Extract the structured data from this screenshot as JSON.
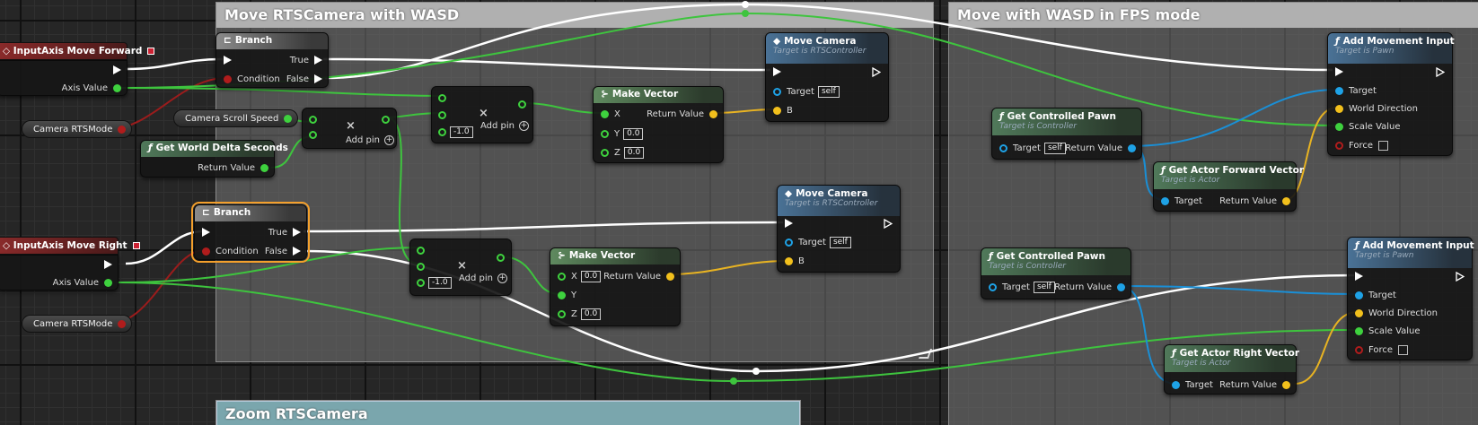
{
  "comments": {
    "move_rts": "Move RTSCamera with WASD",
    "move_fps": "Move with WASD in FPS mode",
    "zoom_rts": "Zoom RTSCamera"
  },
  "events": {
    "forward": "InputAxis Move Forward",
    "right": "InputAxis Move Right",
    "axis_value": "Axis Value"
  },
  "variables": {
    "camera_rts_mode": "Camera RTSMode",
    "camera_scroll_speed": "Camera Scroll Speed"
  },
  "branch": {
    "title": "Branch",
    "condition": "Condition",
    "true": "True",
    "false": "False"
  },
  "delta": {
    "title": "Get World Delta Seconds",
    "return_value": "Return Value"
  },
  "multiply": {
    "add_pin": "Add pin",
    "const": "-1.0"
  },
  "make_vector": {
    "title": "Make Vector",
    "x": "X",
    "y": "Y",
    "z": "Z",
    "zero": "0.0",
    "return_value": "Return Value"
  },
  "move_camera": {
    "title": "Move Camera",
    "subtitle": "Target is RTSController",
    "target": "Target",
    "self": "self",
    "b": "B"
  },
  "controlled_pawn": {
    "title": "Get Controlled Pawn",
    "subtitle": "Target is Controller",
    "target": "Target",
    "self": "self",
    "return_value": "Return Value"
  },
  "forward_vector": {
    "title": "Get Actor Forward Vector",
    "subtitle": "Target is Actor",
    "target": "Target",
    "return_value": "Return Value"
  },
  "right_vector": {
    "title": "Get Actor Right Vector",
    "subtitle": "Target is Actor",
    "target": "Target",
    "return_value": "Return Value"
  },
  "add_movement": {
    "title": "Add Movement Input",
    "subtitle": "Target is Pawn",
    "target": "Target",
    "world_direction": "World Direction",
    "scale_value": "Scale Value",
    "force": "Force"
  },
  "colors": {
    "exec": "#ffffff",
    "float": "#3ed13e",
    "bool": "#b01c1c",
    "vector": "#f2c01c",
    "object": "#1ea2e6",
    "selection": "#f4a02c"
  }
}
